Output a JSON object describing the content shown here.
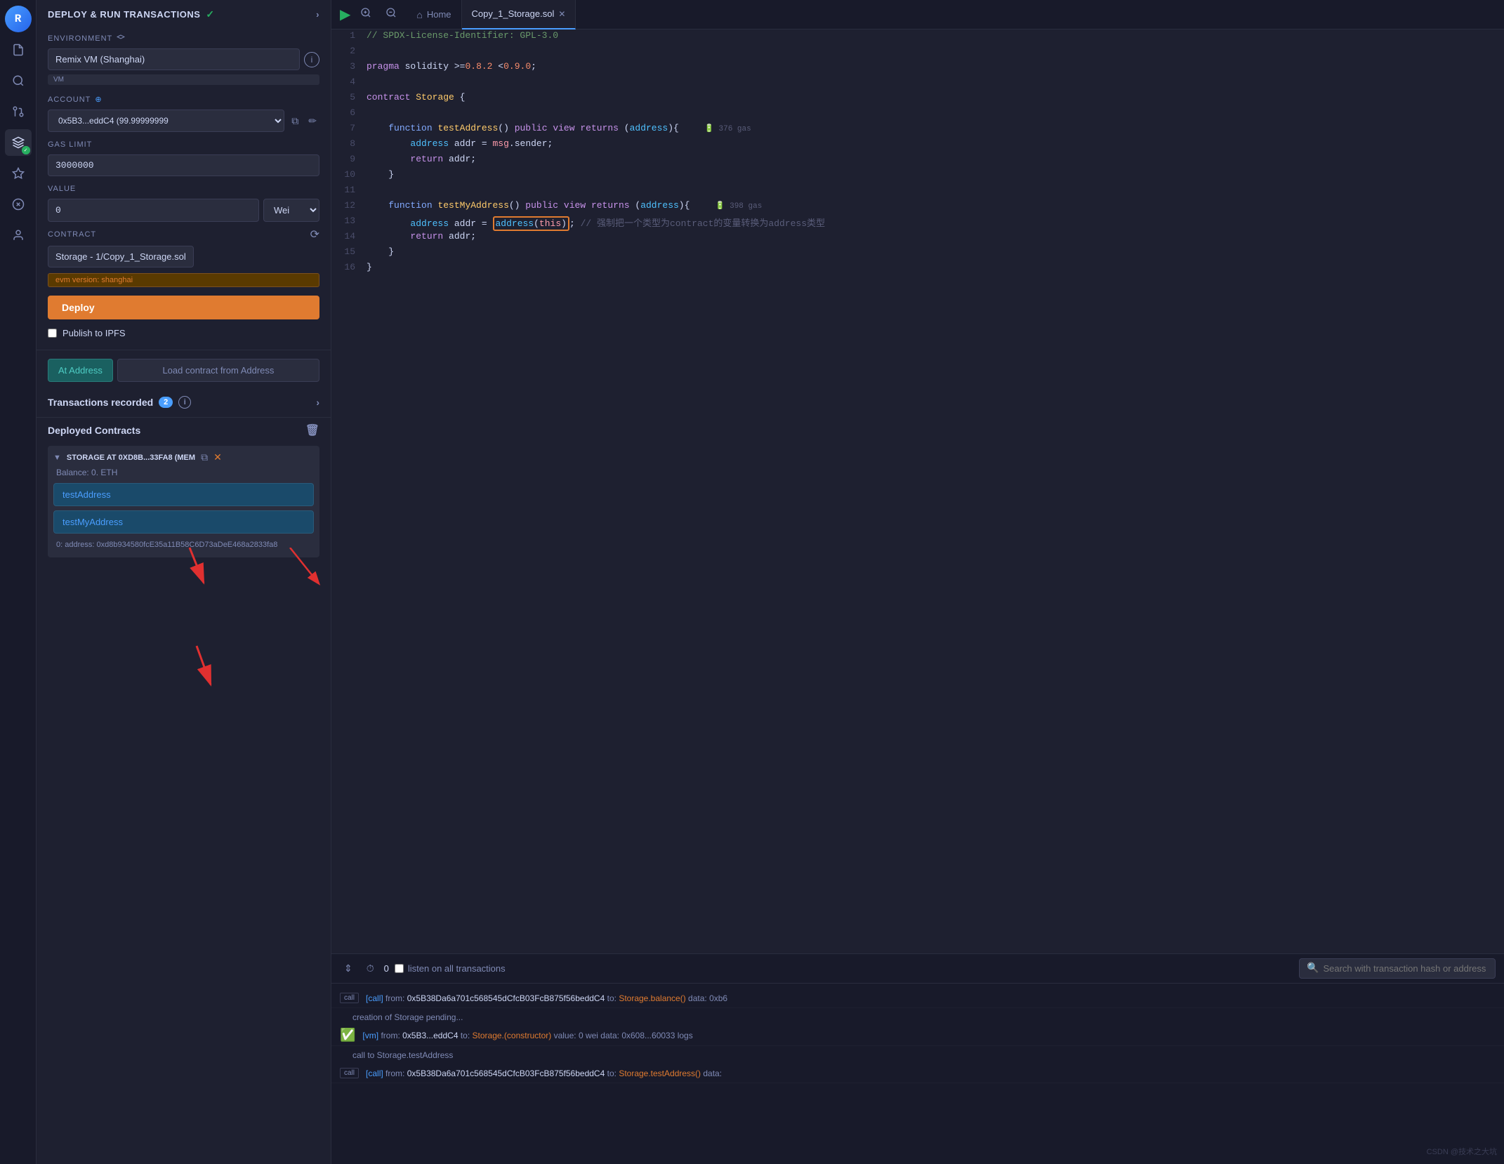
{
  "app": {
    "title": "DEPLOY & RUN TRANSACTIONS"
  },
  "sidebar": {
    "icons": [
      {
        "name": "logo",
        "symbol": "R",
        "class": "logo"
      },
      {
        "name": "files",
        "symbol": "📄",
        "class": ""
      },
      {
        "name": "search",
        "symbol": "🔍",
        "class": ""
      },
      {
        "name": "git",
        "symbol": "⎇",
        "class": ""
      },
      {
        "name": "deploy",
        "symbol": "🚀",
        "class": "active has-check"
      },
      {
        "name": "extensions",
        "symbol": "✦",
        "class": ""
      },
      {
        "name": "settings",
        "symbol": "⚙",
        "class": ""
      },
      {
        "name": "users",
        "symbol": "👤",
        "class": ""
      }
    ]
  },
  "deploy_panel": {
    "title": "DEPLOY & RUN TRANSACTIONS",
    "environment_label": "ENVIRONMENT",
    "environment_value": "Remix VM (Shanghai)",
    "vm_badge": "VM",
    "account_label": "ACCOUNT",
    "account_value": "0x5B3...eddC4 (99.99999999",
    "gas_limit_label": "GAS LIMIT",
    "gas_limit_value": "3000000",
    "value_label": "VALUE",
    "value_value": "0",
    "value_unit": "Wei",
    "contract_label": "CONTRACT",
    "contract_value": "Storage - 1/Copy_1_Storage.sol",
    "evm_badge": "evm version: shanghai",
    "deploy_btn": "Deploy",
    "publish_label": "Publish to IPFS",
    "at_address_btn": "At Address",
    "load_contract_btn": "Load contract from Address",
    "transactions_label": "Transactions recorded",
    "transactions_count": "2",
    "deployed_contracts_label": "Deployed Contracts",
    "contract_instance_name": "STORAGE AT 0XD8B...33FA8 (MEM",
    "balance_label": "Balance: 0. ETH",
    "fn_test_address": "testAddress",
    "fn_test_my_address": "testMyAddress",
    "result_label": "0: address: 0xd8b934580fcE35a11B58C6D73aDeE468a2833fa8"
  },
  "tabs": {
    "home_label": "Home",
    "file_label": "Copy_1_Storage.sol"
  },
  "code": {
    "lines": [
      {
        "num": 1,
        "content": "// SPDX-License-Identifier: GPL-3.0"
      },
      {
        "num": 2,
        "content": ""
      },
      {
        "num": 3,
        "content": "pragma solidity >=0.8.2 <0.9.0;"
      },
      {
        "num": 4,
        "content": ""
      },
      {
        "num": 5,
        "content": "contract Storage {"
      },
      {
        "num": 6,
        "content": ""
      },
      {
        "num": 7,
        "content": "    function testAddress() public view returns (address){    🔋 376 gas"
      },
      {
        "num": 8,
        "content": "        address addr = msg.sender;"
      },
      {
        "num": 9,
        "content": "        return addr;"
      },
      {
        "num": 10,
        "content": "    }"
      },
      {
        "num": 11,
        "content": ""
      },
      {
        "num": 12,
        "content": "    function testMyAddress() public view returns (address){    🔋 398 gas"
      },
      {
        "num": 13,
        "content": "        address addr = address(this); // 强制把一个类型为contract的变量转换为address类型"
      },
      {
        "num": 14,
        "content": "        return addr;"
      },
      {
        "num": 15,
        "content": "    }"
      },
      {
        "num": 16,
        "content": "}"
      }
    ]
  },
  "console": {
    "count": "0",
    "listen_label": "listen on all transactions",
    "search_placeholder": "Search with transaction hash or address",
    "logs": [
      {
        "badge": "call",
        "content": "[call] from: 0x5B38Da6a701c568545dCfcB03FcB875f56beddC4 to: Storage.balance() data: 0xb6",
        "type": "plain"
      },
      {
        "badge": "",
        "content": "creation of Storage pending...",
        "type": "indent"
      },
      {
        "badge": "✓",
        "content": "[vm] from: 0x5B3...eddC4 to: Storage.(constructor) value: 0 wei data: 0x608...60033 logs",
        "type": "success"
      },
      {
        "badge": "",
        "content": "call to Storage.testAddress",
        "type": "indent"
      },
      {
        "badge": "call",
        "content": "[call] from: 0x5B38Da6a701c568545dCfcB03FcB875f56beddC4 to: Storage.testAddress() data:",
        "type": "plain"
      }
    ]
  }
}
